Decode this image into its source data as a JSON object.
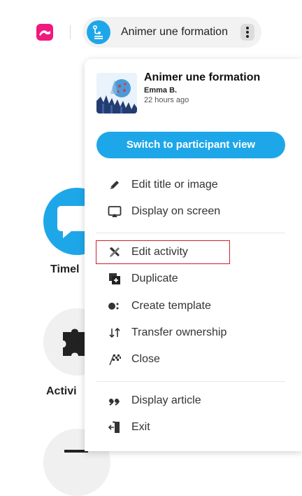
{
  "topbar": {
    "activity_title": "Animer une formation"
  },
  "background": {
    "labels": [
      "Timel",
      "Activi"
    ]
  },
  "menu": {
    "header": {
      "title": "Animer une formation",
      "author": "Emma B.",
      "time": "22 hours ago"
    },
    "switch_button": "Switch to participant view",
    "items": [
      {
        "label": "Edit title or image",
        "icon": "pencil-icon"
      },
      {
        "label": "Display on screen",
        "icon": "cast-screen-icon"
      },
      {
        "label": "Edit activity",
        "icon": "tools-icon"
      },
      {
        "label": "Duplicate",
        "icon": "duplicate-icon"
      },
      {
        "label": "Create template",
        "icon": "template-icon"
      },
      {
        "label": "Transfer ownership",
        "icon": "transfer-icon"
      },
      {
        "label": "Close",
        "icon": "finish-flag-icon"
      },
      {
        "label": "Display article",
        "icon": "quote-icon"
      },
      {
        "label": "Exit",
        "icon": "exit-icon"
      }
    ]
  },
  "colors": {
    "brand_pink": "#f0197d",
    "accent_blue": "#1ea7e8",
    "highlight_red": "#d01f2f"
  }
}
